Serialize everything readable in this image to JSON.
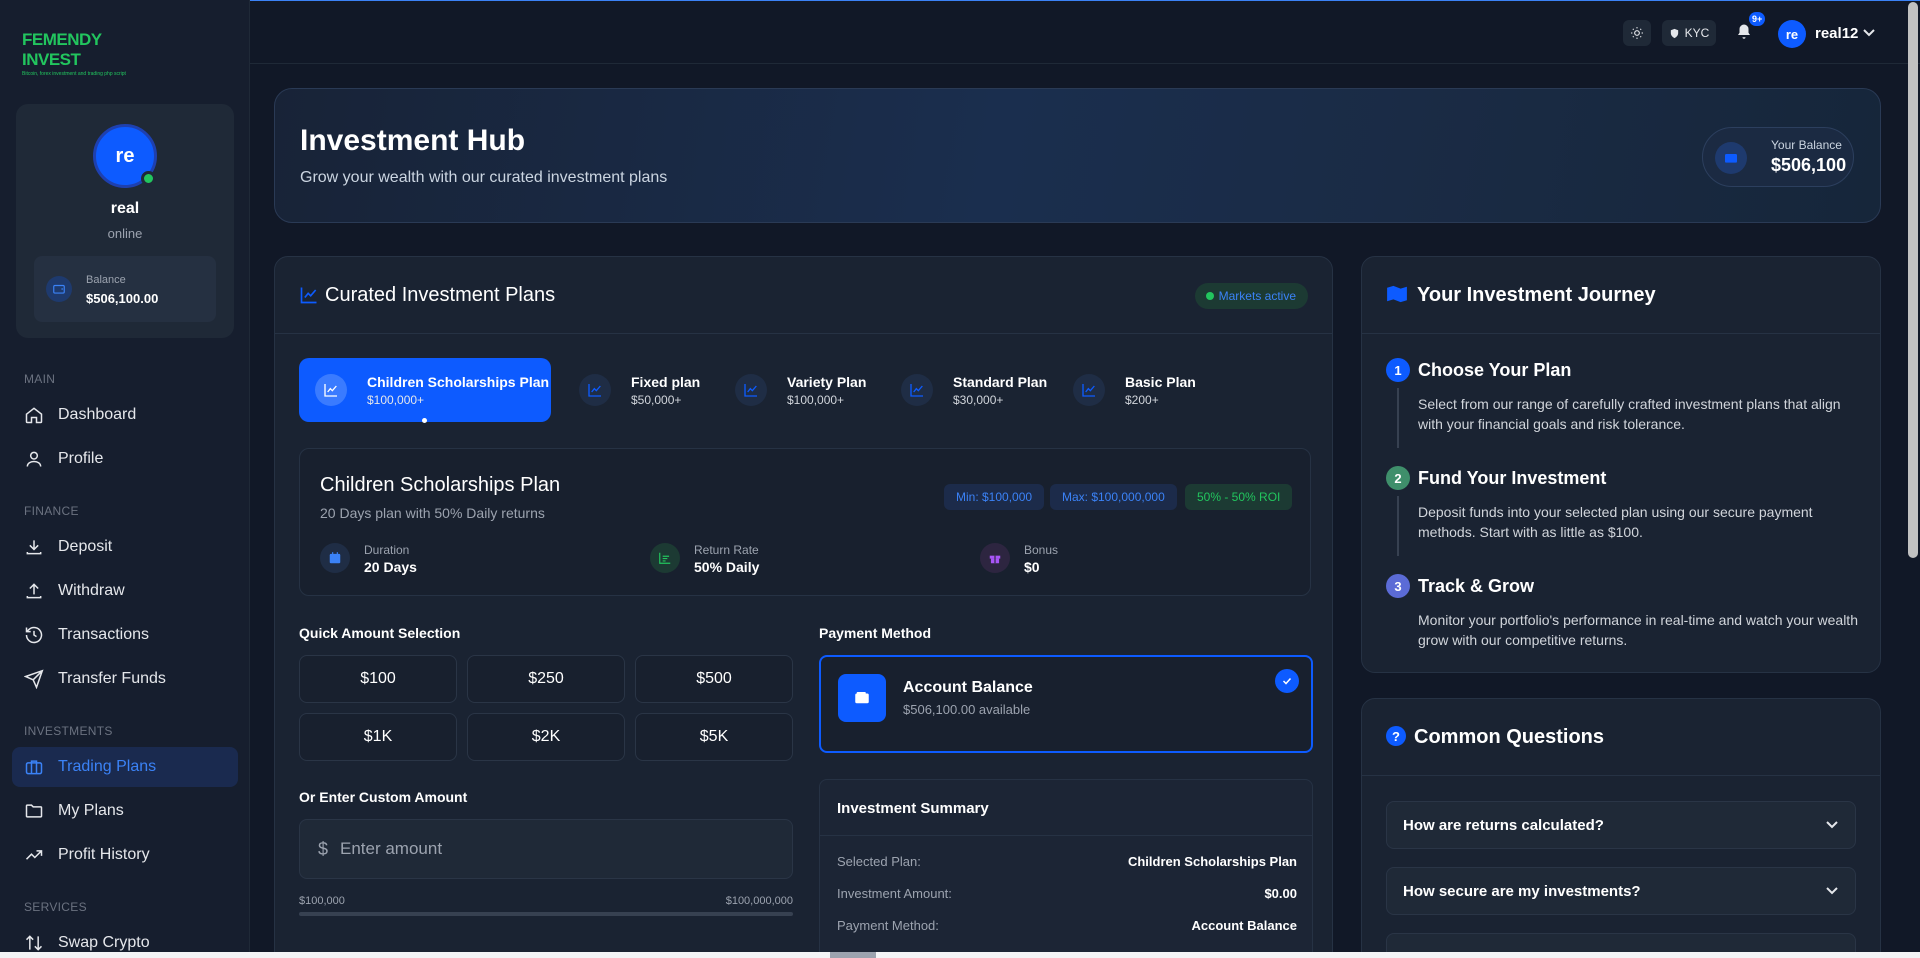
{
  "brand": {
    "name": "FEMENDY INVEST",
    "tagline": "Bitcoin, forex investment and trading php script"
  },
  "topbar": {
    "kyc_label": "KYC",
    "notification_badge": "9+",
    "avatar_initials": "re",
    "username": "real12"
  },
  "profile": {
    "initials": "re",
    "name": "real",
    "status": "online",
    "balance_label": "Balance",
    "balance_value": "$506,100.00"
  },
  "sidebar": {
    "sections": [
      {
        "title": "MAIN",
        "items": [
          {
            "label": "Dashboard",
            "icon": "home-icon"
          },
          {
            "label": "Profile",
            "icon": "user-icon"
          }
        ]
      },
      {
        "title": "FINANCE",
        "items": [
          {
            "label": "Deposit",
            "icon": "download-icon"
          },
          {
            "label": "Withdraw",
            "icon": "upload-icon"
          },
          {
            "label": "Transactions",
            "icon": "history-icon"
          },
          {
            "label": "Transfer Funds",
            "icon": "send-icon"
          }
        ]
      },
      {
        "title": "INVESTMENTS",
        "items": [
          {
            "label": "Trading Plans",
            "icon": "briefcase-icon",
            "active": true
          },
          {
            "label": "My Plans",
            "icon": "folder-icon"
          },
          {
            "label": "Profit History",
            "icon": "trending-up-icon"
          }
        ]
      },
      {
        "title": "SERVICES",
        "items": [
          {
            "label": "Swap Crypto",
            "icon": "swap-icon"
          }
        ]
      }
    ]
  },
  "hero": {
    "title": "Investment Hub",
    "subtitle": "Grow your wealth with our curated investment plans",
    "balance_label": "Your Balance",
    "balance_value": "$506,100"
  },
  "plans": {
    "title": "Curated Investment Plans",
    "markets_status": "Markets active",
    "tabs": [
      {
        "name": "Children Scholarships Plan",
        "min": "$100,000+",
        "active": true
      },
      {
        "name": "Fixed plan",
        "min": "$50,000+"
      },
      {
        "name": "Variety Plan",
        "min": "$100,000+"
      },
      {
        "name": "Standard Plan",
        "min": "$30,000+"
      },
      {
        "name": "Basic Plan",
        "min": "$200+"
      }
    ],
    "detail": {
      "title": "Children Scholarships Plan",
      "subtitle": "20 Days plan with 50% Daily returns",
      "min_pill": "Min: $100,000",
      "max_pill": "Max: $100,000,000",
      "roi_pill": "50% - 50% ROI",
      "duration_label": "Duration",
      "duration_value": "20 Days",
      "return_label": "Return Rate",
      "return_value": "50% Daily",
      "bonus_label": "Bonus",
      "bonus_value": "$0"
    },
    "quick_amount_label": "Quick Amount Selection",
    "quick_amounts": [
      "$100",
      "$250",
      "$500",
      "$1K",
      "$2K",
      "$5K"
    ],
    "custom_label": "Or Enter Custom Amount",
    "currency_symbol": "$",
    "custom_placeholder": "Enter amount",
    "range_min": "$100,000",
    "range_max": "$100,000,000",
    "payment_label": "Payment Method",
    "payment": {
      "title": "Account Balance",
      "available": "$506,100.00 available"
    },
    "summary": {
      "title": "Investment Summary",
      "rows": [
        {
          "k": "Selected Plan:",
          "v": "Children Scholarships Plan"
        },
        {
          "k": "Investment Amount:",
          "v": "$0.00"
        },
        {
          "k": "Payment Method:",
          "v": "Account Balance"
        }
      ]
    }
  },
  "journey": {
    "title": "Your Investment Journey",
    "steps": [
      {
        "num": "1",
        "title": "Choose Your Plan",
        "desc": "Select from our range of carefully crafted investment plans that align with your financial goals and risk tolerance.",
        "color": "#0d5bff"
      },
      {
        "num": "2",
        "title": "Fund Your Investment",
        "desc": "Deposit funds into your selected plan using our secure payment methods. Start with as little as $100.",
        "color": "#3f8f6b"
      },
      {
        "num": "3",
        "title": "Track & Grow",
        "desc": "Monitor your portfolio's performance in real-time and watch your wealth grow with our competitive returns.",
        "color": "#5b6bd6"
      }
    ]
  },
  "faq": {
    "title": "Common Questions",
    "items": [
      "How are returns calculated?",
      "How secure are my investments?"
    ]
  },
  "colors": {
    "accent": "#0d5bff",
    "success": "#22c55e",
    "background": "#111827",
    "card": "#1a2332"
  }
}
